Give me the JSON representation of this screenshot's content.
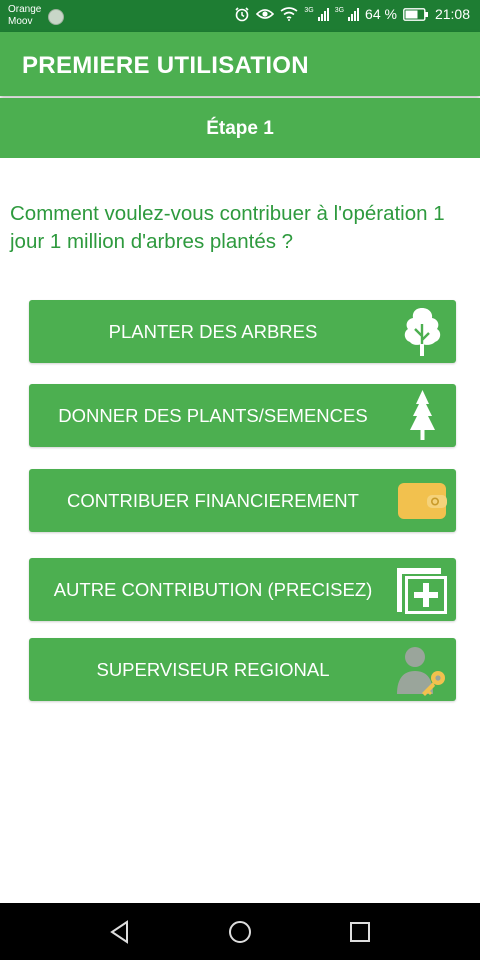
{
  "status_bar": {
    "carrier_line1": "Orange",
    "carrier_line2": "Moov",
    "network_1": "3G",
    "network_2": "3G",
    "battery": "64 %",
    "time": "21:08"
  },
  "app_bar": {
    "title": "PREMIERE UTILISATION"
  },
  "step": {
    "title": "Étape 1"
  },
  "question": "Comment voulez-vous contribuer à l'opération 1 jour 1 million d'arbres plantés ?",
  "options": [
    {
      "label": "PLANTER DES ARBRES",
      "icon": "tree-icon"
    },
    {
      "label": "DONNER DES PLANTS/SEMENCES",
      "icon": "pine-tree-icon"
    },
    {
      "label": "CONTRIBUER FINANCIEREMENT",
      "icon": "wallet-icon"
    },
    {
      "label": "AUTRE CONTRIBUTION (PRECISEZ)",
      "icon": "add-document-icon"
    },
    {
      "label": "SUPERVISEUR REGIONAL",
      "icon": "user-key-icon"
    }
  ],
  "colors": {
    "primary": "#4caf50",
    "status_bar": "#1e7d33",
    "question_text": "#2e9a3e",
    "wallet": "#f2c14e"
  },
  "nav_bar": {
    "back": "back-icon",
    "home": "home-icon",
    "recents": "recents-icon"
  }
}
